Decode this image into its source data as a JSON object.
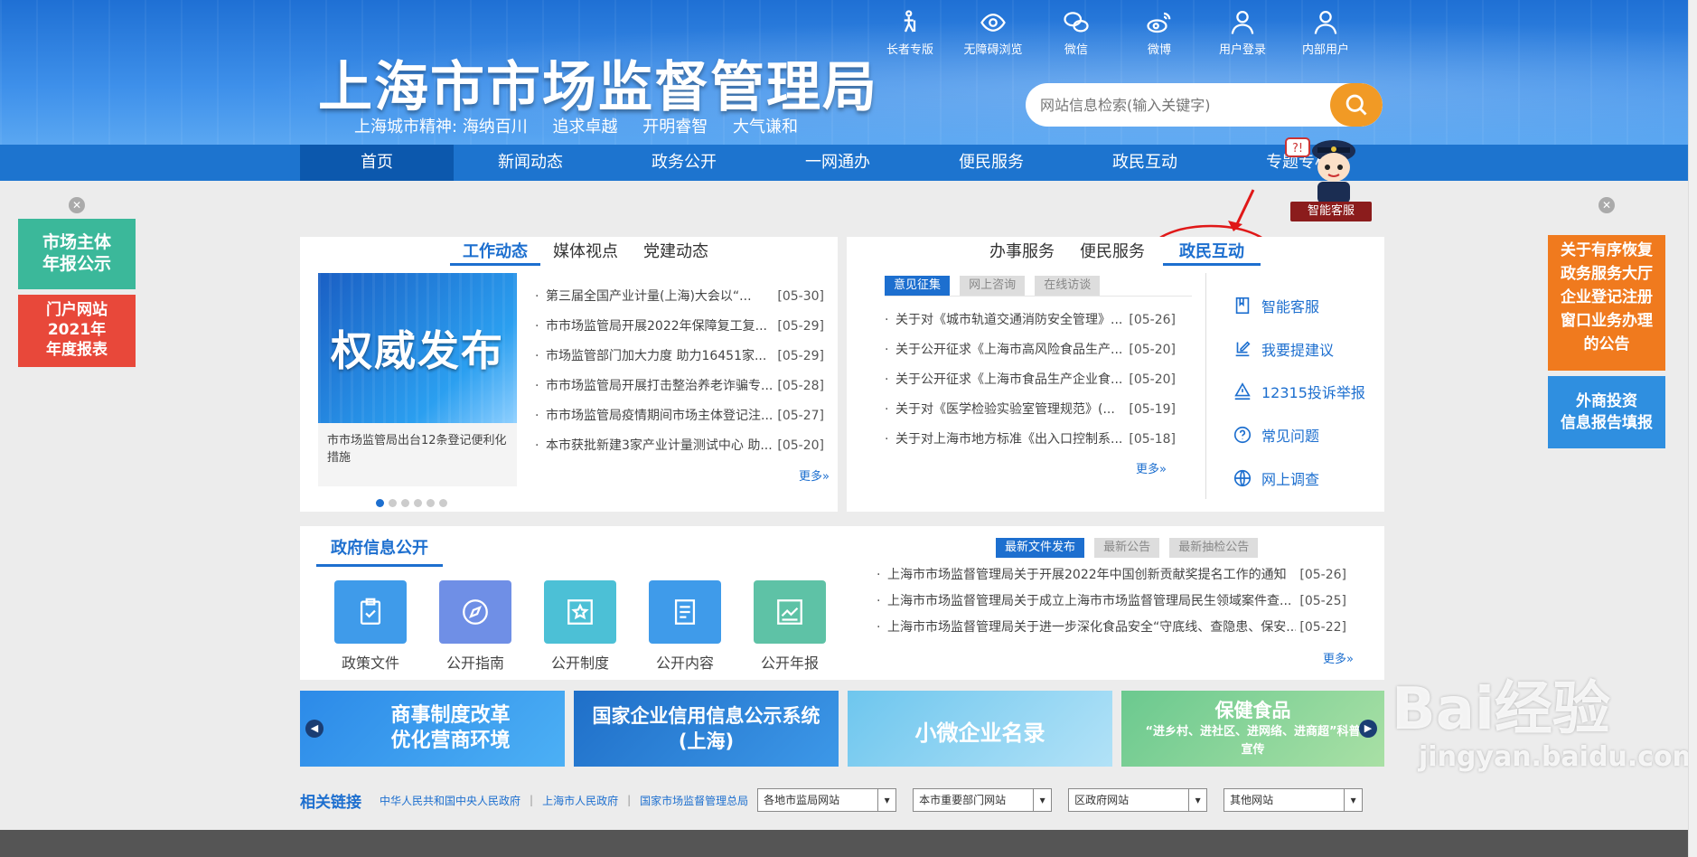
{
  "site": {
    "title": "上海市市场监督管理局",
    "spirit_label": "上海城市精神:",
    "spirit": [
      "海纳百川",
      "追求卓越",
      "开明睿智",
      "大气谦和"
    ]
  },
  "toplinks": [
    {
      "label": "长者专版",
      "icon": "elder-icon"
    },
    {
      "label": "无障碍浏览",
      "icon": "eye-icon"
    },
    {
      "label": "微信",
      "icon": "wechat-icon"
    },
    {
      "label": "微博",
      "icon": "weibo-icon"
    },
    {
      "label": "用户登录",
      "icon": "user-icon"
    },
    {
      "label": "内部用户",
      "icon": "user-icon"
    }
  ],
  "search": {
    "placeholder": "网站信息检索(输入关键字)"
  },
  "nav": [
    "首页",
    "新闻动态",
    "政务公开",
    "一网通办",
    "便民服务",
    "政民互动",
    "专题专栏"
  ],
  "robot": {
    "label": "智能客服"
  },
  "left_ads": [
    {
      "text": "市场主体\n年报公示",
      "color": "#3bb89a"
    },
    {
      "text": "门户网站\n2021年\n年度报表",
      "color": "#e8483a"
    }
  ],
  "right_ads": [
    {
      "text": "关于有序恢复\n政务服务大厅\n企业登记注册\n窗口业务办理\n的公告",
      "color": "#f07a1e"
    },
    {
      "text": "外商投资\n信息报告填报",
      "color": "#2f8fe0"
    }
  ],
  "news": {
    "tabs": [
      "工作动态",
      "媒体视点",
      "党建动态"
    ],
    "slide_text": "权威发布",
    "slide_caption": "市市场监管局出台12条登记便利化措施",
    "items": [
      {
        "title": "第三届全国产业计量(上海)大会以“...",
        "date": "[05-30]"
      },
      {
        "title": "市市场监管局开展2022年保障复工复...",
        "date": "[05-29]"
      },
      {
        "title": "市场监管部门加大力度 助力16451家...",
        "date": "[05-29]"
      },
      {
        "title": "市市场监管局开展打击整治养老诈骗专...",
        "date": "[05-28]"
      },
      {
        "title": "市市场监管局疫情期间市场主体登记注...",
        "date": "[05-27]"
      },
      {
        "title": "本市获批新建3家产业计量测试中心 助...",
        "date": "[05-20]"
      }
    ],
    "more": "更多»"
  },
  "service": {
    "tabs": [
      "办事服务",
      "便民服务",
      "政民互动"
    ],
    "subtabs": [
      "意见征集",
      "网上咨询",
      "在线访谈"
    ],
    "items": [
      {
        "title": "关于对《城市轨道交通消防安全管理》...",
        "date": "[05-26]"
      },
      {
        "title": "关于公开征求《上海市高风险食品生产...",
        "date": "[05-20]"
      },
      {
        "title": "关于公开征求《上海市食品生产企业食...",
        "date": "[05-20]"
      },
      {
        "title": "关于对《医学检验实验室管理规范》(...",
        "date": "[05-19]"
      },
      {
        "title": "关于对上海市地方标准《出入口控制系...",
        "date": "[05-18]"
      }
    ],
    "more": "更多»",
    "quick": [
      {
        "label": "智能客服",
        "icon": "book-icon"
      },
      {
        "label": "我要提建议",
        "icon": "edit-icon"
      },
      {
        "label": "12315投诉举报",
        "icon": "report-icon"
      },
      {
        "label": "常见问题",
        "icon": "question-icon"
      },
      {
        "label": "网上调查",
        "icon": "globe-icon"
      }
    ]
  },
  "gov_info": {
    "title": "政府信息公开",
    "icons": [
      {
        "label": "政策文件",
        "color": "#3f9bea"
      },
      {
        "label": "公开指南",
        "color": "#6f8fe6"
      },
      {
        "label": "公开制度",
        "color": "#4cc0d6"
      },
      {
        "label": "公开内容",
        "color": "#3f9bea"
      },
      {
        "label": "公开年报",
        "color": "#5ec2a6"
      }
    ],
    "subtabs": [
      "最新文件发布",
      "最新公告",
      "最新抽检公告"
    ],
    "items": [
      {
        "title": "上海市市场监督管理局关于开展2022年中国创新贡献奖提名工作的通知",
        "date": "[05-26]"
      },
      {
        "title": "上海市市场监督管理局关于成立上海市市场监督管理局民生领域案件查...",
        "date": "[05-25]"
      },
      {
        "title": "上海市市场监督管理局关于进一步深化食品安全“守底线、查隐患、保安...",
        "date": "[05-22]"
      }
    ],
    "more": "更多»"
  },
  "banners": [
    {
      "line1": "商事制度改革",
      "line2": "优化营商环境"
    },
    {
      "line1": "国家企业信用信息公示系统",
      "line2": "(上海)"
    },
    {
      "line1": "小微企业名录",
      "line2": ""
    },
    {
      "line1": "保健食品",
      "line2": "“进乡村、进社区、进网络、进商超”科普宣传"
    }
  ],
  "links": {
    "label": "相关链接",
    "items": [
      "中华人民共和国中央人民政府",
      "上海市人民政府",
      "国家市场监督管理总局"
    ],
    "selects": [
      "各地市监局网站",
      "本市重要部门网站",
      "区政府网站",
      "其他网站"
    ]
  },
  "watermark": {
    "brand": "Bai经验",
    "domain": "jingyan.baidu.com"
  }
}
